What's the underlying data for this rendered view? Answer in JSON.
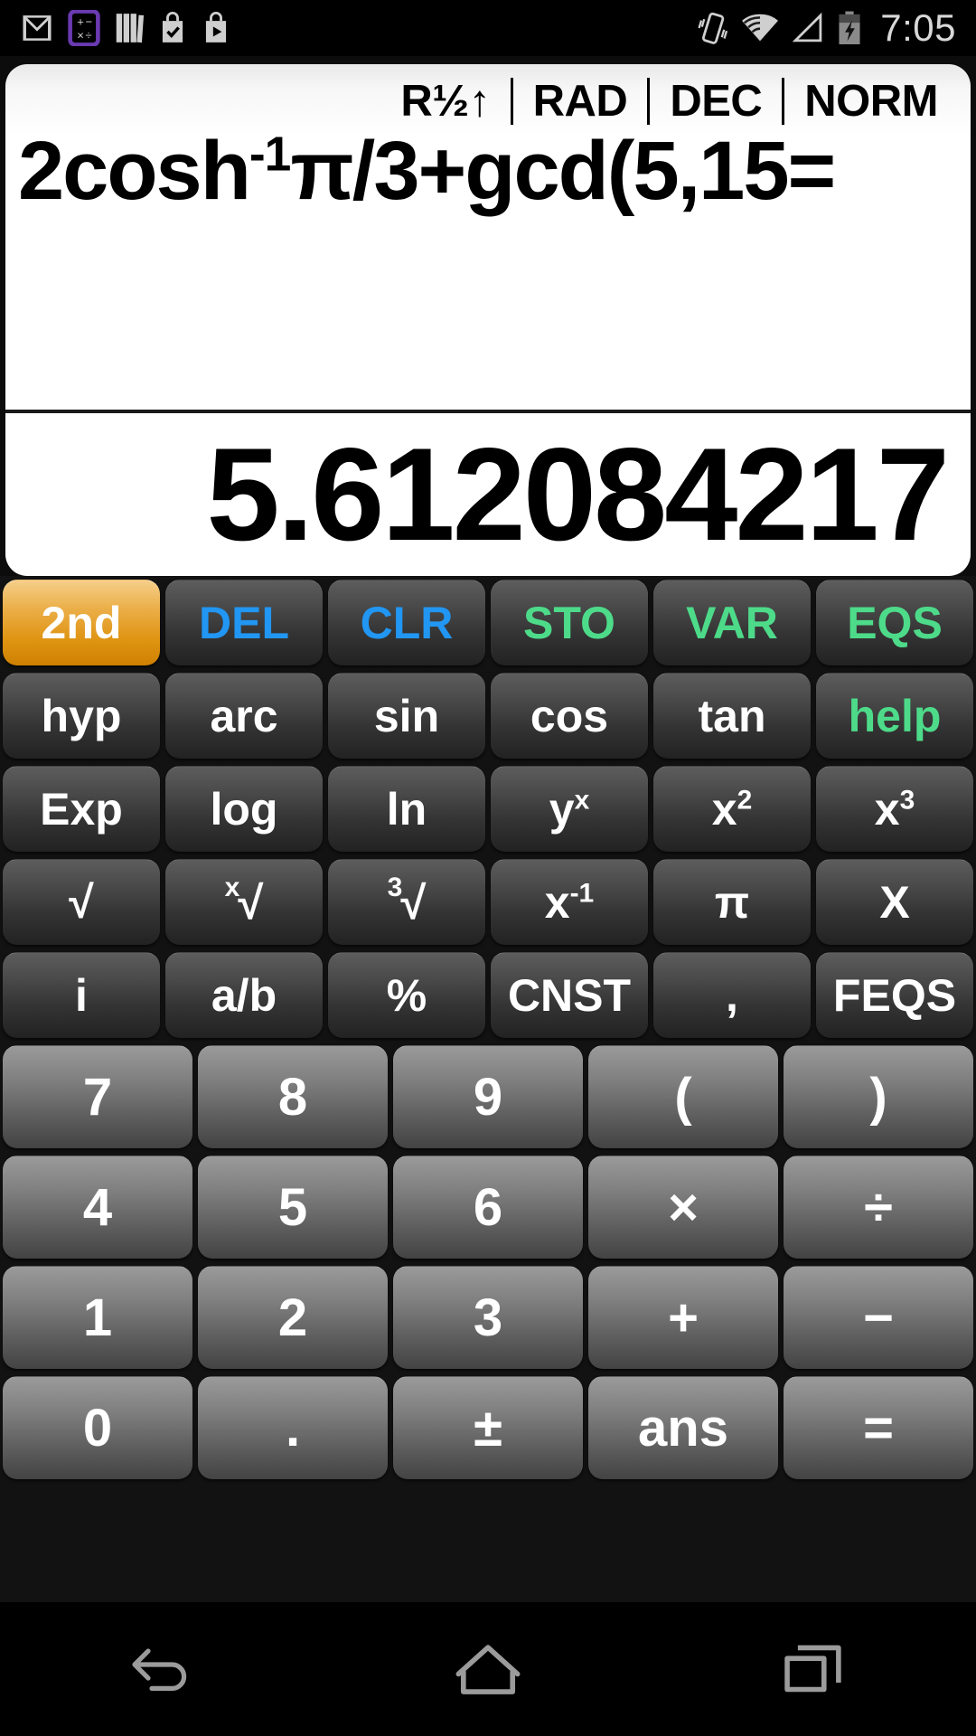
{
  "statusbar": {
    "time": "7:05",
    "left_icons": [
      "gmail-icon",
      "calculator-icon",
      "books-icon",
      "tasks-bag-icon",
      "play-bag-icon"
    ],
    "right_icons": [
      "vibrate-icon",
      "wifi-icon",
      "cell-signal-icon",
      "battery-charging-icon"
    ]
  },
  "display": {
    "indicators": [
      {
        "label": "R½↑"
      },
      {
        "label": "RAD"
      },
      {
        "label": "DEC"
      },
      {
        "label": "NORM"
      }
    ],
    "expression_parts": {
      "p1": "2cosh",
      "sup1": "-1",
      "p2": "π/3+gcd(5,15="
    },
    "expression_plain": "2cosh-1π/3+gcd(5,15=",
    "result": "5.612084217"
  },
  "keypad": {
    "rows": [
      {
        "type": "fn",
        "keys": [
          {
            "label": "2nd",
            "style": "second"
          },
          {
            "label": "DEL",
            "style": "blue"
          },
          {
            "label": "CLR",
            "style": "blue"
          },
          {
            "label": "STO",
            "style": "green"
          },
          {
            "label": "VAR",
            "style": "green"
          },
          {
            "label": "EQS",
            "style": "green"
          }
        ]
      },
      {
        "type": "fn",
        "keys": [
          {
            "label": "hyp",
            "style": "plain"
          },
          {
            "label": "arc",
            "style": "plain"
          },
          {
            "label": "sin",
            "style": "plain"
          },
          {
            "label": "cos",
            "style": "plain"
          },
          {
            "label": "tan",
            "style": "plain"
          },
          {
            "label": "help",
            "style": "green"
          }
        ]
      },
      {
        "type": "fn",
        "keys": [
          {
            "label": "Exp",
            "style": "plain"
          },
          {
            "label": "log",
            "style": "plain"
          },
          {
            "label": "ln",
            "style": "plain"
          },
          {
            "label": "y",
            "sup": "x",
            "style": "plain"
          },
          {
            "label": "x",
            "sup": "2",
            "style": "plain"
          },
          {
            "label": "x",
            "sup": "3",
            "style": "plain"
          }
        ]
      },
      {
        "type": "fn",
        "keys": [
          {
            "label": "√",
            "style": "plain"
          },
          {
            "pre": "x",
            "label": "√",
            "style": "plain"
          },
          {
            "pre": "3",
            "label": "√",
            "style": "plain"
          },
          {
            "label": "x",
            "sup": "-1",
            "style": "plain"
          },
          {
            "label": "π",
            "style": "plain"
          },
          {
            "label": "X",
            "style": "plain"
          }
        ]
      },
      {
        "type": "fn",
        "keys": [
          {
            "label": "i",
            "style": "plain"
          },
          {
            "label": "a/b",
            "style": "plain"
          },
          {
            "label": "%",
            "style": "plain"
          },
          {
            "label": "CNST",
            "style": "plain",
            "small": true
          },
          {
            "label": ",",
            "style": "plain"
          },
          {
            "label": "FEQS",
            "style": "plain",
            "small": true
          }
        ]
      },
      {
        "type": "num",
        "keys": [
          {
            "label": "7"
          },
          {
            "label": "8"
          },
          {
            "label": "9"
          },
          {
            "label": "("
          },
          {
            "label": ")"
          }
        ]
      },
      {
        "type": "num",
        "keys": [
          {
            "label": "4"
          },
          {
            "label": "5"
          },
          {
            "label": "6"
          },
          {
            "label": "×"
          },
          {
            "label": "÷"
          }
        ]
      },
      {
        "type": "num",
        "keys": [
          {
            "label": "1"
          },
          {
            "label": "2"
          },
          {
            "label": "3"
          },
          {
            "label": "+"
          },
          {
            "label": "−"
          }
        ]
      },
      {
        "type": "num",
        "keys": [
          {
            "label": "0"
          },
          {
            "label": "."
          },
          {
            "label": "±"
          },
          {
            "label": "ans"
          },
          {
            "label": "="
          }
        ]
      }
    ]
  },
  "navbar": {
    "buttons": [
      "back-icon",
      "home-icon",
      "recents-icon"
    ]
  },
  "colors": {
    "accent_orange": "#df9412",
    "blue": "#2196f3",
    "green": "#4ddb8a",
    "display_bg": "#ffffff",
    "keypad_bg": "#121212"
  }
}
